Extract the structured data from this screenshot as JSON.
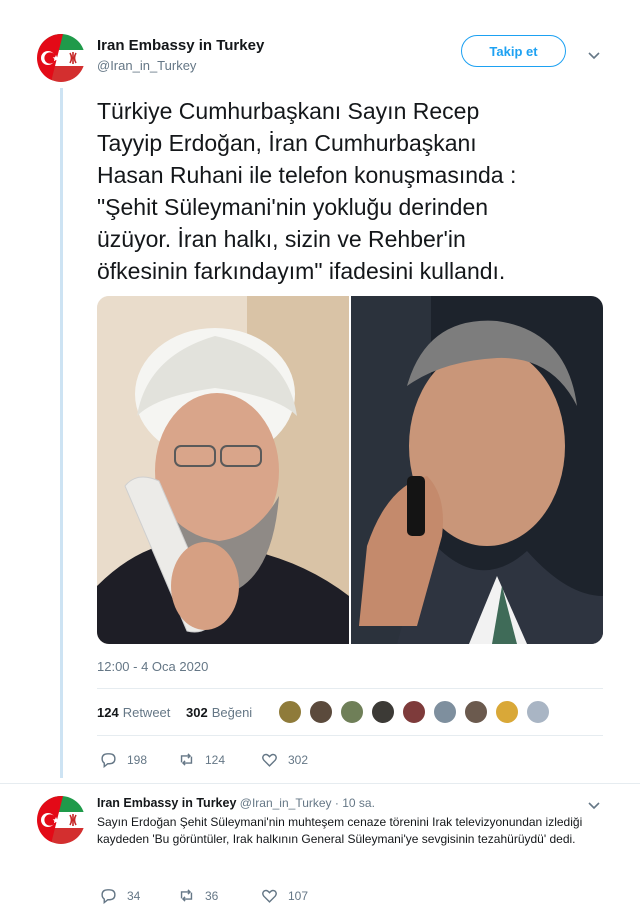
{
  "main_tweet": {
    "author_name": "Iran Embassy in Turkey",
    "author_handle": "@Iran_in_Turkey",
    "follow_label": "Takip et",
    "text": "Türkiye Cumhurbaşkanı Sayın Recep\nTayyip Erdoğan, İran Cumhurbaşkanı\nHasan Ruhani ile telefon konuşmasında :\n\"Şehit Süleymani'nin yokluğu derinden\nüzüyor. İran halkı, sizin ve Rehber'in\nöfkesinin farkındayım\" ifadesini kullandı.",
    "timestamp": "12:00 - 4 Oca 2020",
    "retweet_count": "124",
    "retweet_label": "Retweet",
    "like_count": "302",
    "like_label": "Beğeni",
    "actions": {
      "reply": "198",
      "retweet": "124",
      "like": "302"
    },
    "avatar_icon": "turkey-iran-flag-icon"
  },
  "reply_tweet": {
    "author_name": "Iran Embassy in Turkey",
    "author_handle": "@Iran_in_Turkey",
    "time_ago": "· 10 sa.",
    "text": "Sayın Erdoğan Şehit Süleymani'nin muhteşem cenaze törenini Irak televizyonundan izlediği kaydeden 'Bu görüntüler, Irak halkının General Süleymani'ye sevgisinin tezahürüydü'  dedi.",
    "actions": {
      "reply": "34",
      "retweet": "36",
      "like": "107"
    }
  },
  "colors": {
    "accent": "#1da1f2",
    "muted": "#657786",
    "thread": "#cde3f3"
  }
}
